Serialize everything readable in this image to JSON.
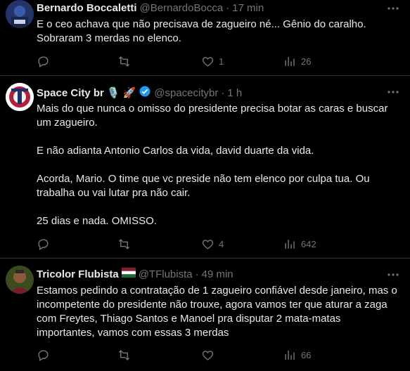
{
  "tweets": [
    {
      "name": "Bernardo Boccaletti",
      "handle": "@BernardoBocca",
      "time": "17 min",
      "body": [
        "E o ceo achava que não precisava de zagueiro né... Gênio do caralho.",
        "Sobraram 3 merdas no elenco."
      ],
      "replies": "",
      "retweets": "",
      "likes": "1",
      "views": "26"
    },
    {
      "name": "Space City br",
      "handle": "@spacecitybr",
      "time": "1 h",
      "body": [
        "Mais do que nunca o omisso do presidente precisa botar as caras e buscar um zagueiro.",
        "E não adianta Antonio Carlos da vida, david duarte da vida.",
        "Acorda, Mario. O time que vc preside não tem elenco por culpa tua. Ou trabalha ou vai lutar pra não cair.",
        "25 dias e nada. OMISSO."
      ],
      "replies": "",
      "retweets": "",
      "likes": "4",
      "views": "642"
    },
    {
      "name": "Tricolor Flubista",
      "handle": "@TFlubista",
      "time": "49 min",
      "body": [
        "Estamos pedindo a contratação de 1 zagueiro confiável desde janeiro, mas o incompetente do presidente não trouxe, agora vamos ter que aturar a zaga com Freytes, Thiago Santos e Manoel pra disputar 2 mata-matas importantes, vamos com essas 3 merdas"
      ],
      "replies": "",
      "retweets": "",
      "likes": "",
      "views": "66"
    }
  ],
  "colors": {
    "background": "#000000",
    "text": "#e7e9ea",
    "muted": "#71767b",
    "divider": "#2f3336",
    "verified": "#1d9bf0"
  }
}
